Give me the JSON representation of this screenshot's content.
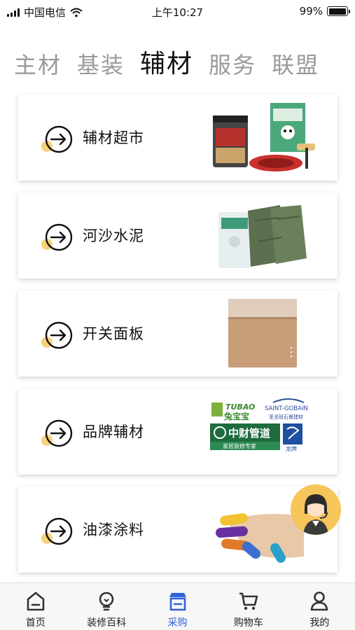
{
  "status_bar": {
    "carrier": "中国电信",
    "time": "上午10:27",
    "battery": "99%",
    "battery_level": 0.99
  },
  "tabs": [
    {
      "label": "主材",
      "active": false
    },
    {
      "label": "基装",
      "active": false
    },
    {
      "label": "辅材",
      "active": true
    },
    {
      "label": "服务",
      "active": false
    },
    {
      "label": "联盟",
      "active": false
    }
  ],
  "cards": [
    {
      "label": "辅材超市",
      "image": "paint-buckets-and-cable"
    },
    {
      "label": "河沙水泥",
      "image": "sand-cement-bags"
    },
    {
      "label": "开关面板",
      "image": "switch-panel"
    },
    {
      "label": "品牌辅材",
      "image": "brand-logos"
    },
    {
      "label": "油漆涂料",
      "image": "painted-fingers"
    }
  ],
  "brand_logos": {
    "tubao_en": "TUBAO",
    "tubao_cn": "兔宝宝",
    "saint_gobain": "SAINT-GOBAIN",
    "gypsum": "圣戈班石膏建材",
    "zhongcai": "中财管道",
    "zhongcai_sub": "家居装修专家",
    "longpai": "龙牌"
  },
  "bottom_nav": [
    {
      "label": "首页",
      "icon": "home-icon",
      "active": false
    },
    {
      "label": "装修百科",
      "icon": "bulb-icon",
      "active": false
    },
    {
      "label": "采购",
      "icon": "store-icon",
      "active": true
    },
    {
      "label": "购物车",
      "icon": "cart-icon",
      "active": false
    },
    {
      "label": "我的",
      "icon": "user-icon",
      "active": false
    }
  ],
  "colors": {
    "accent_yellow": "#f6c65b",
    "active_blue": "#2f63d8",
    "inactive_tab": "#9a9a9a"
  }
}
